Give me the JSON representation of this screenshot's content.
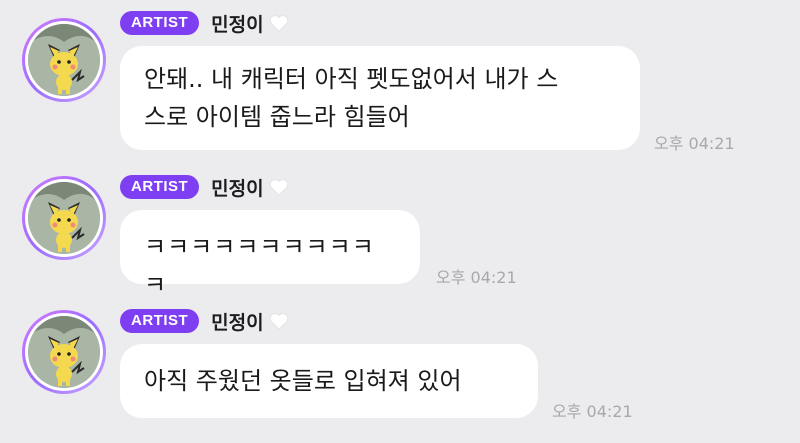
{
  "messages": [
    {
      "badge": "ARTIST",
      "name": "민정이",
      "lines": [
        "안돼.. 내 캐릭터 아직 펫도없어서 내가 스",
        "스로 아이템 줍느라 힘들어"
      ],
      "time": "오후 04:21"
    },
    {
      "badge": "ARTIST",
      "name": "민정이",
      "lines": [
        "ㅋㅋㅋㅋㅋㅋㅋㅋㅋㅋㅋ"
      ],
      "time": "오후 04:21"
    },
    {
      "badge": "ARTIST",
      "name": "민정이",
      "lines": [
        "아직 주웠던 옷들로 입혀져 있어"
      ],
      "time": "오후 04:21"
    }
  ],
  "colors": {
    "background": "#ececee",
    "badge": "#7e3ff2",
    "bubble": "#ffffff",
    "timestamp": "#a8a8ad"
  },
  "icons": {
    "avatar": "pichu-avatar",
    "heart": "white-heart-icon"
  }
}
